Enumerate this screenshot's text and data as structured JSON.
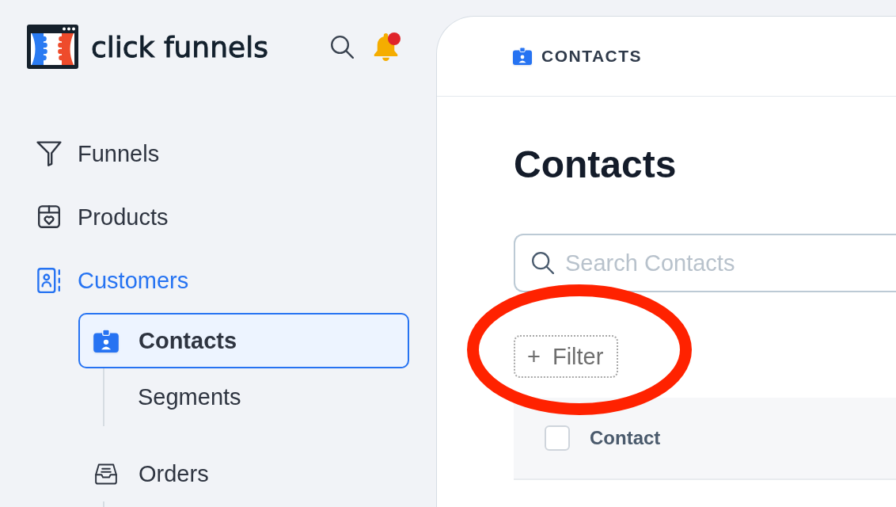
{
  "sidebar": {
    "brand": "click funnels",
    "notifications": {
      "unread": true
    },
    "nav": [
      {
        "label": "Funnels",
        "selected": false
      },
      {
        "label": "Products",
        "selected": false
      },
      {
        "label": "Customers",
        "selected": true,
        "children": [
          {
            "label": "Contacts",
            "selected": true,
            "expanded": true,
            "children": [
              {
                "label": "Segments",
                "selected": false
              }
            ]
          },
          {
            "label": "Orders",
            "selected": false,
            "expanded": true
          }
        ]
      }
    ]
  },
  "main": {
    "breadcrumb": "CONTACTS",
    "title": "Contacts",
    "search": {
      "placeholder": "Search Contacts"
    },
    "filter_button": {
      "icon": "+",
      "label": "Filter"
    },
    "table": {
      "select_all": {
        "checked": false
      },
      "columns": [
        {
          "label": "Contact"
        }
      ]
    }
  },
  "annotation": {
    "kind": "ellipse"
  }
}
